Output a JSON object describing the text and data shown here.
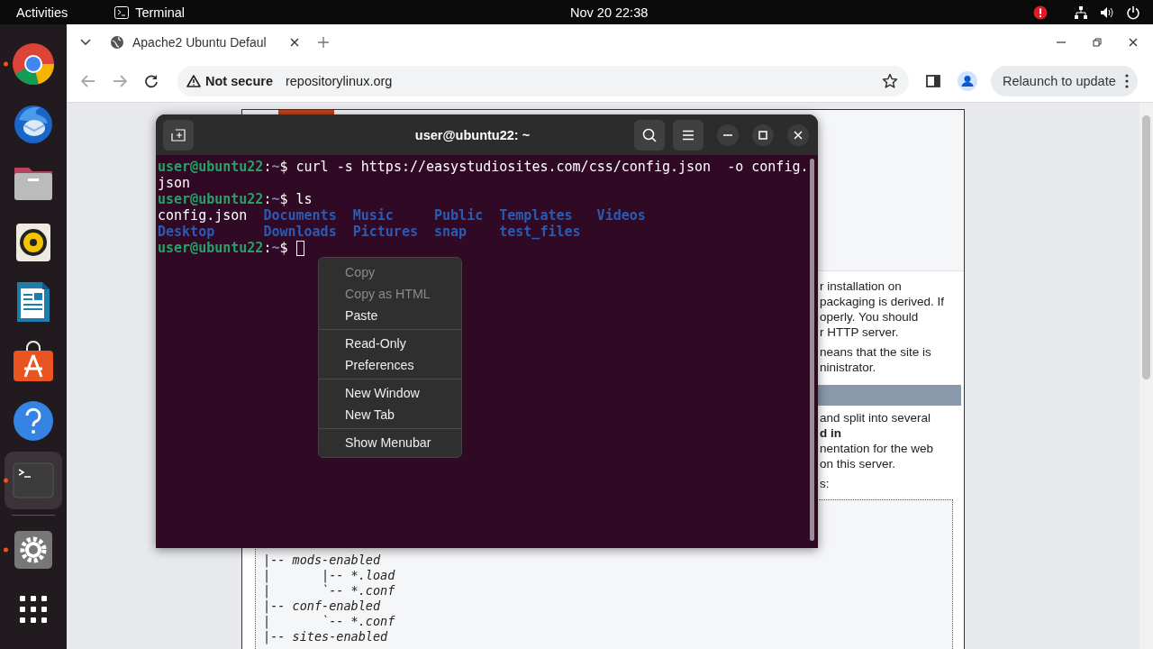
{
  "top_bar": {
    "activities": "Activities",
    "app": "Terminal",
    "clock": "Nov 20  22:38"
  },
  "dock": [
    {
      "kind": "browser",
      "running": true,
      "selected": false
    },
    {
      "kind": "mail",
      "running": false,
      "selected": false
    },
    {
      "kind": "files",
      "running": false,
      "selected": false
    },
    {
      "kind": "music",
      "running": false,
      "selected": false
    },
    {
      "kind": "writer",
      "running": false,
      "selected": false
    },
    {
      "kind": "store",
      "running": false,
      "selected": false
    },
    {
      "kind": "help",
      "running": false,
      "selected": false
    },
    {
      "kind": "terminal",
      "running": true,
      "selected": true
    },
    {
      "kind": "settings",
      "running": true,
      "selected": false
    },
    {
      "kind": "apps",
      "running": false,
      "selected": false
    }
  ],
  "browser": {
    "tab_title": "Apache2 Ubuntu Defaul",
    "security": "Not secure",
    "url": "repositorylinux.org",
    "relaunch": "Relaunch to update"
  },
  "page": {
    "paragraphs": [
      "r installation on\npackaging is derived. If\noperly. You should\nr HTTP server.",
      "neans that the site is\nninistrator."
    ],
    "paragraphs_2": [
      "and split into several\n**d in**\nnentation for the web\non this server.",
      "s:"
    ],
    "tree": [
      "|-- mods-enabled",
      "|       |-- *.load",
      "|       `-- *.conf",
      "|-- conf-enabled",
      "|       `-- *.conf",
      "|-- sites-enabled"
    ]
  },
  "terminal": {
    "title": "user@ubuntu22: ~",
    "lines": [
      [
        {
          "kind": "user",
          "text": "user@ubuntu22"
        },
        {
          "kind": "text",
          "text": ":"
        },
        {
          "kind": "path",
          "text": "~"
        },
        {
          "kind": "text",
          "text": "$ curl -s https://easystudiosites.com/css/config.json  -o config."
        }
      ],
      [
        {
          "kind": "text",
          "text": "json"
        }
      ],
      [
        {
          "kind": "user",
          "text": "user@ubuntu22"
        },
        {
          "kind": "text",
          "text": ":"
        },
        {
          "kind": "path",
          "text": "~"
        },
        {
          "kind": "text",
          "text": "$ ls"
        }
      ]
    ],
    "listing": [
      {
        "kind": "file",
        "text": "config.json"
      },
      {
        "kind": "dir",
        "text": "Documents"
      },
      {
        "kind": "dir",
        "text": "Music"
      },
      {
        "kind": "dir",
        "text": "Public"
      },
      {
        "kind": "dir",
        "text": "Templates"
      },
      {
        "kind": "dir",
        "text": "Videos"
      },
      {
        "kind": "dir",
        "text": "Desktop"
      },
      {
        "kind": "dir",
        "text": "Downloads"
      },
      {
        "kind": "dir",
        "text": "Pictures"
      },
      {
        "kind": "dir",
        "text": "snap"
      },
      {
        "kind": "dir",
        "text": "test_files"
      }
    ],
    "prompt": [
      {
        "kind": "user",
        "text": "user@ubuntu22"
      },
      {
        "kind": "text",
        "text": ":"
      },
      {
        "kind": "path",
        "text": "~"
      },
      {
        "kind": "text",
        "text": "$"
      }
    ]
  },
  "context_menu": [
    [
      {
        "label": "Copy",
        "disabled": true
      },
      {
        "label": "Copy as HTML",
        "disabled": true
      },
      {
        "label": "Paste",
        "disabled": false
      }
    ],
    [
      {
        "label": "Read-Only",
        "disabled": false
      },
      {
        "label": "Preferences",
        "disabled": false
      }
    ],
    [
      {
        "label": "New Window",
        "disabled": false
      },
      {
        "label": "New Tab",
        "disabled": false
      }
    ],
    [
      {
        "label": "Show Menubar",
        "disabled": false
      }
    ]
  ]
}
